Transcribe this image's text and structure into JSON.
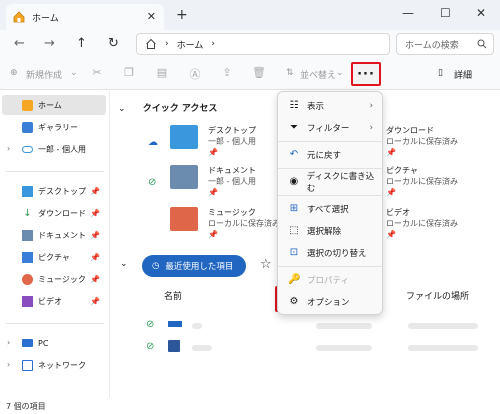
{
  "window": {
    "tab_title": "ホーム",
    "tab_close": "✕",
    "new_tab": "+",
    "minimize": "—",
    "maximize": "☐",
    "close": "✕"
  },
  "nav": {
    "back": "←",
    "forward": "→",
    "up": "↑",
    "refresh": "↻",
    "breadcrumb_sep": "›",
    "breadcrumb": [
      "ホーム"
    ],
    "search_placeholder": "ホームの検索"
  },
  "toolbar": {
    "new_label": "新規作成",
    "sort_label": "並べ替え",
    "more_label": "···",
    "details_label": "詳細"
  },
  "sidebar": {
    "items": [
      {
        "label": "ホーム",
        "active": true
      },
      {
        "label": "ギャラリー"
      },
      {
        "label": "一郎 - 個人用",
        "expandable": true
      },
      {
        "label": "デスクトップ",
        "pinned": true
      },
      {
        "label": "ダウンロード",
        "pinned": true
      },
      {
        "label": "ドキュメント",
        "pinned": true
      },
      {
        "label": "ピクチャ",
        "pinned": true
      },
      {
        "label": "ミュージック",
        "pinned": true
      },
      {
        "label": "ビデオ",
        "pinned": true
      },
      {
        "label": "PC",
        "expandable": true
      },
      {
        "label": "ネットワーク",
        "expandable": true
      }
    ]
  },
  "quick_access": {
    "heading": "クイック アクセス",
    "items": [
      {
        "name": "デスクトップ",
        "sub": "一郎 - 個人用",
        "color": "#3a96dd"
      },
      {
        "name": "ドキュメント",
        "sub": "一郎 - 個人用",
        "color": "#6b8cae"
      },
      {
        "name": "ミュージック",
        "sub": "ローカルに保存済み",
        "color": "#e0664a"
      },
      {
        "name": "ダウンロード",
        "sub": "ローカルに保存済み",
        "color": "#2e9c59"
      },
      {
        "name": "ピクチャ",
        "sub": "ローカルに保存済み",
        "color": "#3a7ed8"
      },
      {
        "name": "ビデオ",
        "sub": "ローカルに保存済み",
        "color": "#8a4dbf"
      }
    ]
  },
  "recent": {
    "button_label": "最近使用した項目",
    "col_name": "名前",
    "col_location": "ファイルの場所"
  },
  "context_menu": {
    "items": [
      {
        "label": "表示",
        "submenu": true
      },
      {
        "label": "フィルター",
        "submenu": true
      },
      {
        "label": "元に戻す"
      },
      {
        "label": "ディスクに書き込む"
      },
      {
        "label": "すべて選択"
      },
      {
        "label": "選択解除"
      },
      {
        "label": "選択の切り替え"
      },
      {
        "label": "プロパティ",
        "disabled": true
      },
      {
        "label": "オプション",
        "highlighted": true
      }
    ]
  },
  "status": {
    "item_count": "7 個の項目"
  },
  "colors": {
    "accent": "#2166c1",
    "highlight_border": "#e0141e"
  }
}
